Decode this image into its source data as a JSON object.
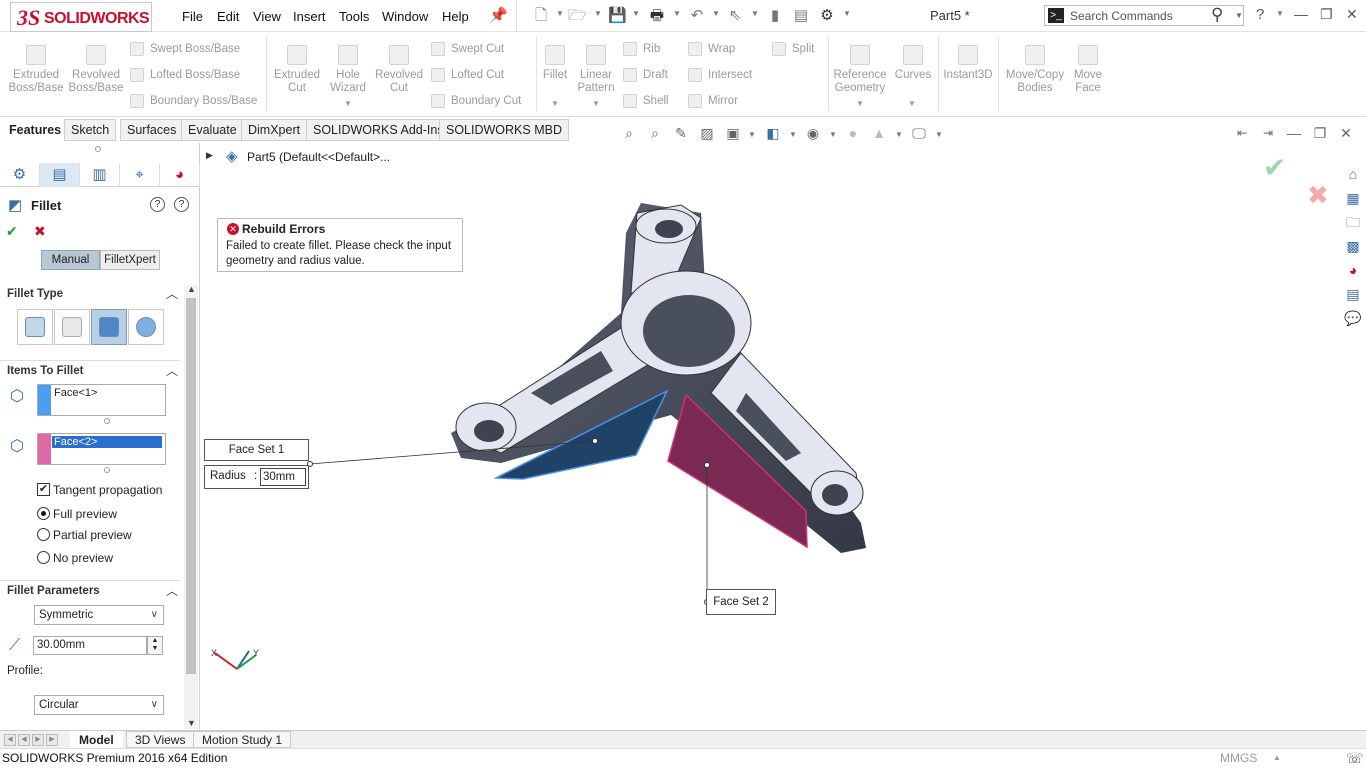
{
  "app": {
    "brand": "SOLIDWORKS",
    "doc_title": "Part5 *",
    "menus": [
      "File",
      "Edit",
      "View",
      "Insert",
      "Tools",
      "Window",
      "Help"
    ],
    "search_placeholder": "Search Commands",
    "help_label": "?"
  },
  "command_manager": {
    "extruded_boss": "Extruded Boss/Base",
    "revolved_boss": "Revolved Boss/Base",
    "swept_boss": "Swept Boss/Base",
    "lofted_boss": "Lofted Boss/Base",
    "boundary_boss": "Boundary Boss/Base",
    "extruded_cut": "Extruded Cut",
    "hole_wizard": "Hole Wizard",
    "revolved_cut": "Revolved Cut",
    "swept_cut": "Swept Cut",
    "lofted_cut": "Lofted Cut",
    "boundary_cut": "Boundary Cut",
    "fillet": "Fillet",
    "linear_pattern": "Linear Pattern",
    "rib": "Rib",
    "draft": "Draft",
    "shell": "Shell",
    "wrap": "Wrap",
    "intersect": "Intersect",
    "mirror": "Mirror",
    "split": "Split",
    "reference_geometry": "Reference Geometry",
    "curves": "Curves",
    "instant3d": "Instant3D",
    "move_copy_bodies": "Move/Copy Bodies",
    "move_face": "Move Face"
  },
  "tabs": [
    "Features",
    "Sketch",
    "Surfaces",
    "Evaluate",
    "DimXpert",
    "SOLIDWORKS Add-Ins",
    "SOLIDWORKS MBD"
  ],
  "property_manager": {
    "title": "Fillet",
    "modes": [
      "Manual",
      "FilletXpert"
    ],
    "fillet_type_header": "Fillet Type",
    "items_header": "Items To Fillet",
    "item1": "Face<1>",
    "item2": "Face<2>",
    "tangent_propagation": "Tangent propagation",
    "preview_options": [
      "Full preview",
      "Partial preview",
      "No preview"
    ],
    "selected_preview": "Full preview",
    "params_header": "Fillet Parameters",
    "method": "Symmetric",
    "radius_value": "30.00mm",
    "profile_label": "Profile:",
    "profile_value": "Circular"
  },
  "tree": {
    "root": "Part5  (Default<<Default>..."
  },
  "rebuild_error": {
    "title": "Rebuild Errors",
    "message": "Failed to create fillet. Please check the input geometry and radius value."
  },
  "callouts": {
    "face_set_1": "Face Set 1",
    "radius_label": "Radius",
    "radius_sep": ":",
    "radius_value": "30mm",
    "face_set_2": "Face Set 2"
  },
  "triad": {
    "x": "X",
    "y": "Y"
  },
  "bottom_tabs": [
    "Model",
    "3D Views",
    "Motion Study 1"
  ],
  "status": {
    "edition": "SOLIDWORKS Premium 2016 x64 Edition",
    "units": "MMGS"
  },
  "colors": {
    "brand_red": "#c8102e",
    "face1": "#1f4266",
    "face1_edge": "#4a90e2",
    "face2": "#7a2a52",
    "face2_edge": "#d0307a",
    "model_body": "#4a4f5c",
    "model_top": "#e3e6f0"
  }
}
